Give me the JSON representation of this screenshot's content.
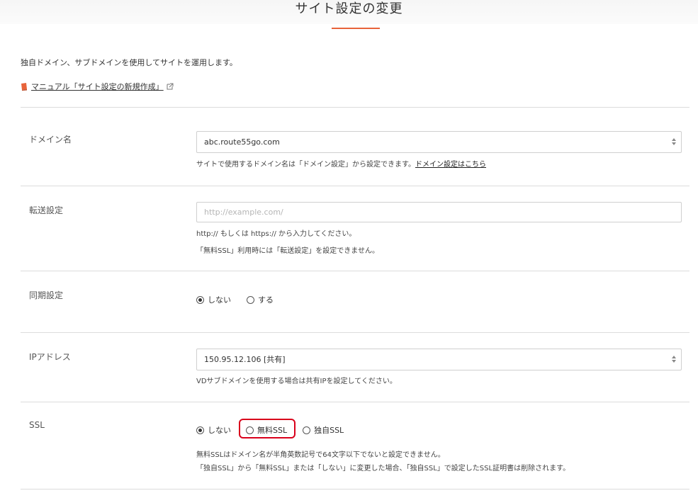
{
  "page": {
    "title": "サイト設定の変更",
    "accent_color": "#e8633a"
  },
  "intro": {
    "text": "独自ドメイン、サブドメインを使用してサイトを運用します。",
    "manual_link": "マニュアル「サイト設定の新規作成」",
    "manual_icon": "book-icon",
    "external_icon": "external-link-icon"
  },
  "domain": {
    "label": "ドメイン名",
    "selected": "abc.route55go.com",
    "help": "サイトで使用するドメイン名は「ドメイン設定」から設定できます。",
    "help_link": "ドメイン設定はこちら"
  },
  "redirect": {
    "label": "転送設定",
    "value": "",
    "placeholder": "http://example.com/",
    "help1": "http:// もしくは https:// から入力してください。",
    "help2": "「無料SSL」利用時には「転送設定」を設定できません。"
  },
  "sync": {
    "label": "同期設定",
    "options": [
      "しない",
      "する"
    ],
    "selected": "しない"
  },
  "ip": {
    "label": "IPアドレス",
    "selected": "150.95.12.106 [共有]",
    "help": "VDサブドメインを使用する場合は共有IPを設定してください。"
  },
  "ssl": {
    "label": "SSL",
    "options": [
      "しない",
      "無料SSL",
      "独自SSL"
    ],
    "selected": "しない",
    "highlight_color": "#d9001b",
    "help1": "無料SSLはドメイン名が半角英数記号で64文字以下でないと設定できません。",
    "help2": "「独自SSL」から「無料SSL」または「しない」に変更した場合、「独自SSL」で設定したSSL証明書は削除されます。"
  }
}
